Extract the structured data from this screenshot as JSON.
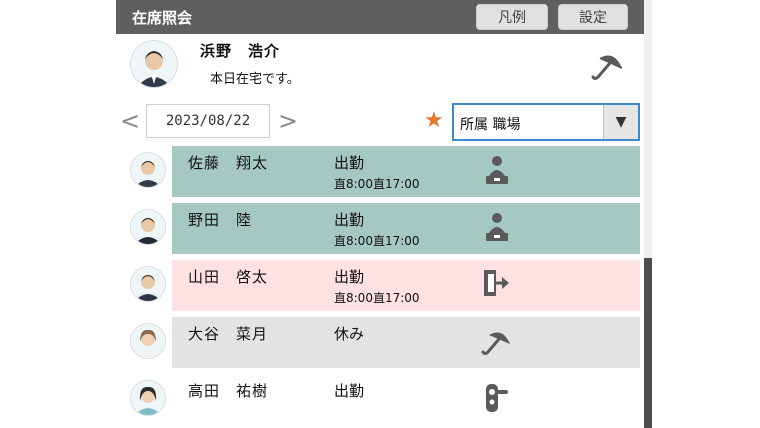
{
  "header": {
    "title": "在席照会",
    "legend_label": "凡例",
    "settings_label": "設定"
  },
  "current_user": {
    "name": "浜野　浩介",
    "status": "本日在宅です。",
    "status_icon": "umbrella-icon"
  },
  "date_nav": {
    "prev_label": "<",
    "date": "2023/08/22",
    "next_label": ">"
  },
  "filter": {
    "favorite_icon": "★",
    "selected": "所属 職場",
    "dropdown_icon": "▼"
  },
  "members": [
    {
      "name": "佐藤　翔太",
      "state": "出勤",
      "hours": "直8:00直17:00",
      "bg": "#a5c9c0",
      "icon": "desk-icon"
    },
    {
      "name": "野田　陸",
      "state": "出勤",
      "hours": "直8:00直17:00",
      "bg": "#a5c9c0",
      "icon": "desk-icon"
    },
    {
      "name": "山田　啓太",
      "state": "出勤",
      "hours": "直8:00直17:00",
      "bg": "#fde1e3",
      "icon": "exit-icon"
    },
    {
      "name": "大谷　菜月",
      "state": "休み",
      "hours": "",
      "bg": "#e3e3e3",
      "icon": "umbrella-icon"
    },
    {
      "name": "高田　祐樹",
      "state": "出勤",
      "hours": "",
      "bg": "#ffffff",
      "icon": "door-lock-icon"
    }
  ]
}
